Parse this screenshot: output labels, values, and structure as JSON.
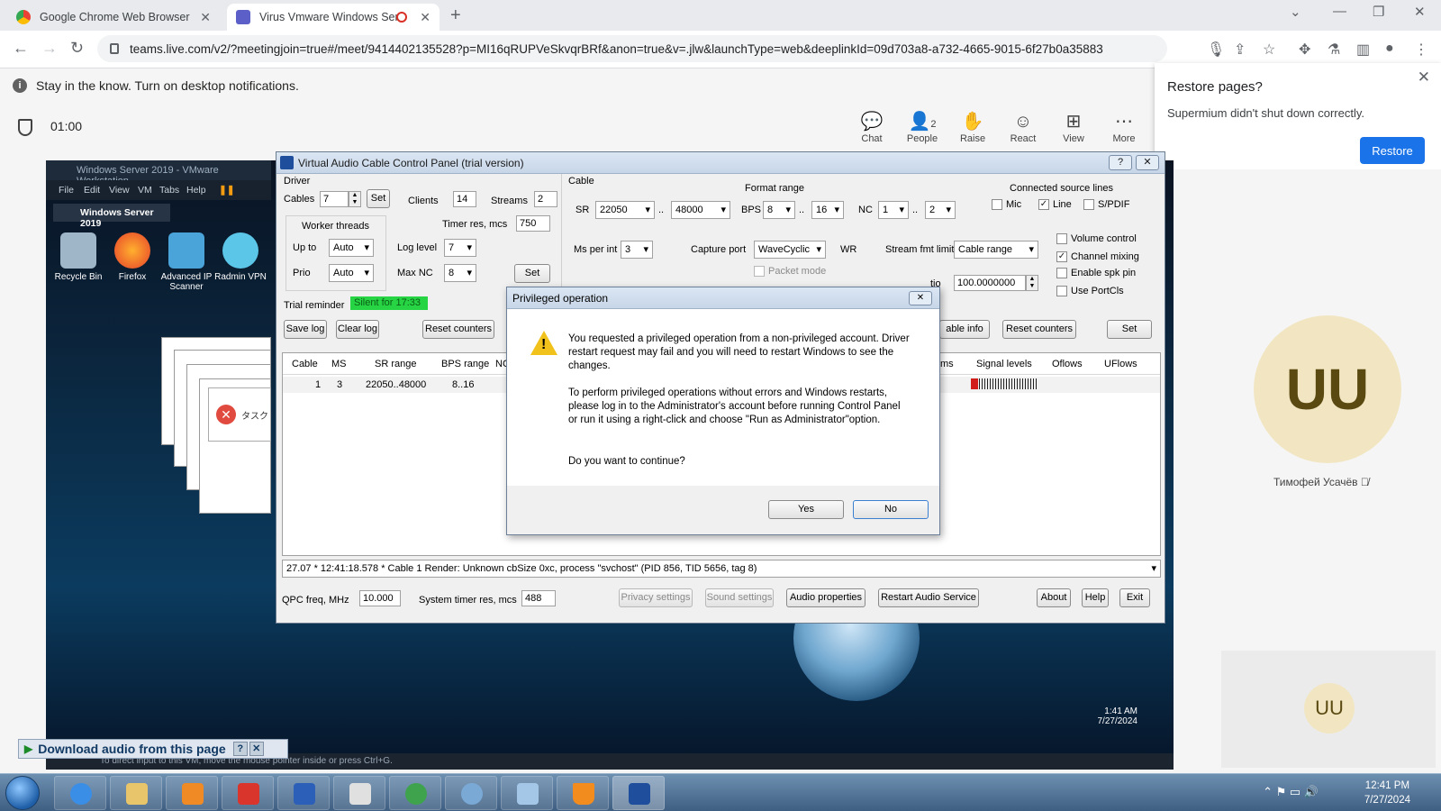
{
  "browser": {
    "tabs": [
      {
        "label": "Google Chrome Web Browser",
        "active": false
      },
      {
        "label": "Virus Vmware Windows Ser",
        "active": true
      }
    ],
    "url": "teams.live.com/v2/?meetingjoin=true#/meet/9414402135528?p=MI16qRUPVeSkvqrBRf&anon=true&v=.jlw&launchType=web&deeplinkId=09d703a8-a732-4665-9015-6f27b0a35883",
    "notification": "Stay in the know. Turn on desktop notifications.",
    "restore_popup": {
      "title": "Restore pages?",
      "message": "Supermium didn't shut down correctly.",
      "button": "Restore"
    }
  },
  "meeting": {
    "timer": "01:00",
    "buttons": {
      "chat": "Chat",
      "people": "People",
      "people_count": "2",
      "raise": "Raise",
      "react": "React",
      "view": "View",
      "more": "More"
    },
    "participant": {
      "initials": "UU",
      "name": "Тимофей Усачёв"
    },
    "self_initials": "UU"
  },
  "vm": {
    "window_title": "Windows Server 2019 - VMware Workstation",
    "menu": [
      "File",
      "Edit",
      "View",
      "VM",
      "Tabs",
      "Help"
    ],
    "tab": "Windows Server 2019",
    "desktop_icons": [
      "Recycle Bin",
      "Firefox",
      "Advanced IP Scanner",
      "Radmin VPN"
    ],
    "error_text": "タスク",
    "clock_time": "1:41 AM",
    "clock_date": "7/27/2024",
    "status_text": "To direct input to this VM, move the mouse pointer inside or press Ctrl+G."
  },
  "download_bar": "Download audio from this page",
  "vac": {
    "title": "Virtual Audio Cable Control Panel (trial version)",
    "driver": {
      "group": "Driver",
      "cables_label": "Cables",
      "cables": "7",
      "set": "Set",
      "clients_label": "Clients",
      "clients": "14",
      "streams_label": "Streams",
      "streams": "2",
      "worker_threads": "Worker threads",
      "timer_label": "Timer res, mcs",
      "timer": "750",
      "upto_label": "Up to",
      "upto": "Auto",
      "loglevel_label": "Log level",
      "loglevel": "7",
      "prio_label": "Prio",
      "prio": "Auto",
      "maxnc_label": "Max NC",
      "maxnc": "8",
      "set2": "Set",
      "trial_label": "Trial reminder",
      "trial_value": "Silent for 17:33",
      "save_log": "Save log",
      "clear_log": "Clear log",
      "reset_counters": "Reset counters"
    },
    "cable": {
      "group": "Cable",
      "format_range": "Format range",
      "sr_label": "SR",
      "sr_min": "22050",
      "sr_max": "48000",
      "bps_label": "BPS",
      "bps_min": "8",
      "bps_max": "16",
      "nc_label": "NC",
      "nc_min": "1",
      "nc_max": "2",
      "range_sep": "..",
      "connected_lines": "Connected source lines",
      "mic": "Mic",
      "line": "Line",
      "spdif": "S/PDIF",
      "ms_per_int_label": "Ms per int",
      "ms_per_int": "3",
      "capture_port_label": "Capture port",
      "capture_port": "WaveCyclic",
      "wr": "WR",
      "stream_fmt_label": "Stream fmt limit",
      "stream_fmt": "Cable range",
      "packet_mode": "Packet mode",
      "ratio_label": "tio",
      "ratio": "100.0000000",
      "volume_control": "Volume control",
      "channel_mixing": "Channel mixing",
      "enable_spk_pin": "Enable spk pin",
      "use_portcls": "Use PortCls",
      "cable_info": "able info",
      "reset_counters": "Reset counters",
      "set": "Set"
    },
    "list": {
      "headers": [
        "Cable",
        "MS",
        "SR range",
        "BPS range",
        "NC",
        "ms",
        "Signal levels",
        "Oflows",
        "UFlows"
      ],
      "row": {
        "cable": "1",
        "ms": "3",
        "sr_range": "22050..48000",
        "bps_range": "8..16"
      }
    },
    "log_line": "27.07 * 12:41:18.578 * Cable 1 Render: Unknown cbSize 0xc, process \"svchost\" (PID 856, TID 5656, tag 8)",
    "footer": {
      "qpc_label": "QPC freq, MHz",
      "qpc": "10.000",
      "sys_timer_label": "System timer res, mcs",
      "sys_timer": "488",
      "privacy": "Privacy settings",
      "sound": "Sound settings",
      "audio_props": "Audio properties",
      "restart": "Restart Audio Service",
      "about": "About",
      "help": "Help",
      "exit": "Exit"
    }
  },
  "dialog": {
    "title": "Privileged operation",
    "p1": "You requested a privileged operation from a non-privileged account. Driver restart request may fail and you will need to restart Windows to see the changes.",
    "p2": "To perform privileged operations without errors and Windows restarts, please log in to the Administrator's account before running Control Panel or run it using a right-click and choose \"Run as Administrator\"option.",
    "p3": "Do you want to continue?",
    "yes": "Yes",
    "no": "No"
  },
  "host_clock": {
    "time": "12:41 PM",
    "date": "7/27/2024"
  },
  "colors": {
    "teams_accent": "#1a73e8",
    "trial_badge": "#27d444",
    "avatar_bg": "#f2e6c2"
  }
}
